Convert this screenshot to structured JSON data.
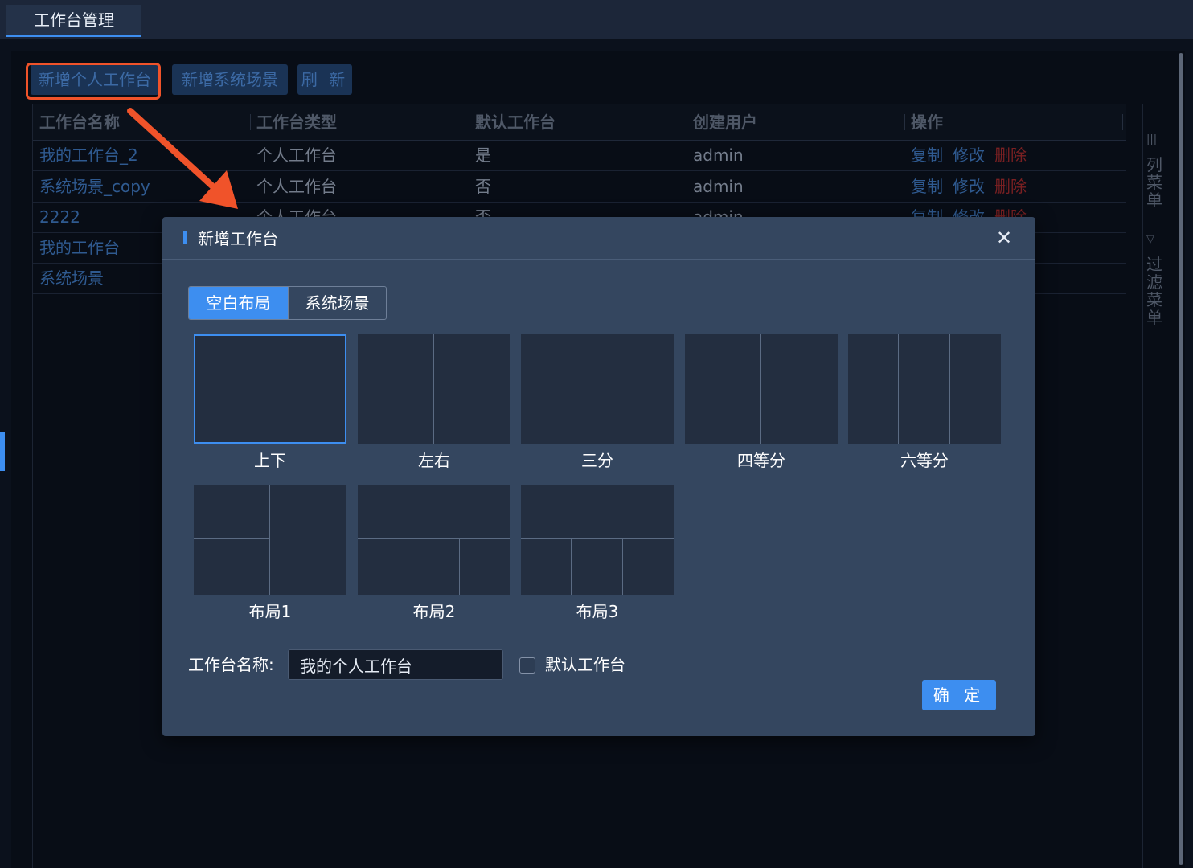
{
  "tabs": {
    "active_label": "工作台管理"
  },
  "toolbar": {
    "add_personal_label": "新增个人工作台",
    "add_system_label": "新增系统场景",
    "refresh_label": "刷 新"
  },
  "table": {
    "columns": [
      "工作台名称",
      "工作台类型",
      "默认工作台",
      "创建用户",
      "操作"
    ],
    "rows": [
      {
        "name": "我的工作台_2",
        "type": "个人工作台",
        "default": "是",
        "user": "admin",
        "op_copy": "复制",
        "op_edit": "修改",
        "op_delete": "删除"
      },
      {
        "name": "系统场景_copy",
        "type": "个人工作台",
        "default": "否",
        "user": "admin",
        "op_copy": "复制",
        "op_edit": "修改",
        "op_delete": "删除"
      },
      {
        "name": "2222",
        "type": "个人工作台",
        "default": "否",
        "user": "admin",
        "op_copy": "复制",
        "op_edit": "修改",
        "op_delete": "删除"
      },
      {
        "name": "我的工作台"
      },
      {
        "name": "系统场景"
      }
    ]
  },
  "side_menu": {
    "column_menu_label": "列菜单",
    "filter_menu_label": "过滤菜单",
    "column_icon": "columns-icon",
    "filter_icon": "filter-icon"
  },
  "modal": {
    "title": "新增工作台",
    "close_icon": "close-icon",
    "segments": {
      "blank_label": "空白布局",
      "system_label": "系统场景",
      "selected": "空白布局"
    },
    "layouts": [
      {
        "label": "上下",
        "selected": true
      },
      {
        "label": "左右"
      },
      {
        "label": "三分"
      },
      {
        "label": "四等分"
      },
      {
        "label": "六等分"
      },
      {
        "label": "布局1"
      },
      {
        "label": "布局2"
      },
      {
        "label": "布局3"
      }
    ],
    "name_field": {
      "label": "工作台名称:",
      "value": "我的个人工作台"
    },
    "default_checkbox": {
      "label": "默认工作台",
      "checked": false
    },
    "confirm_label": "确 定"
  },
  "colors": {
    "accent": "#3d8ef0",
    "highlight": "#f0532a",
    "delete": "#7b2022",
    "modal_bg": "#34465f"
  }
}
